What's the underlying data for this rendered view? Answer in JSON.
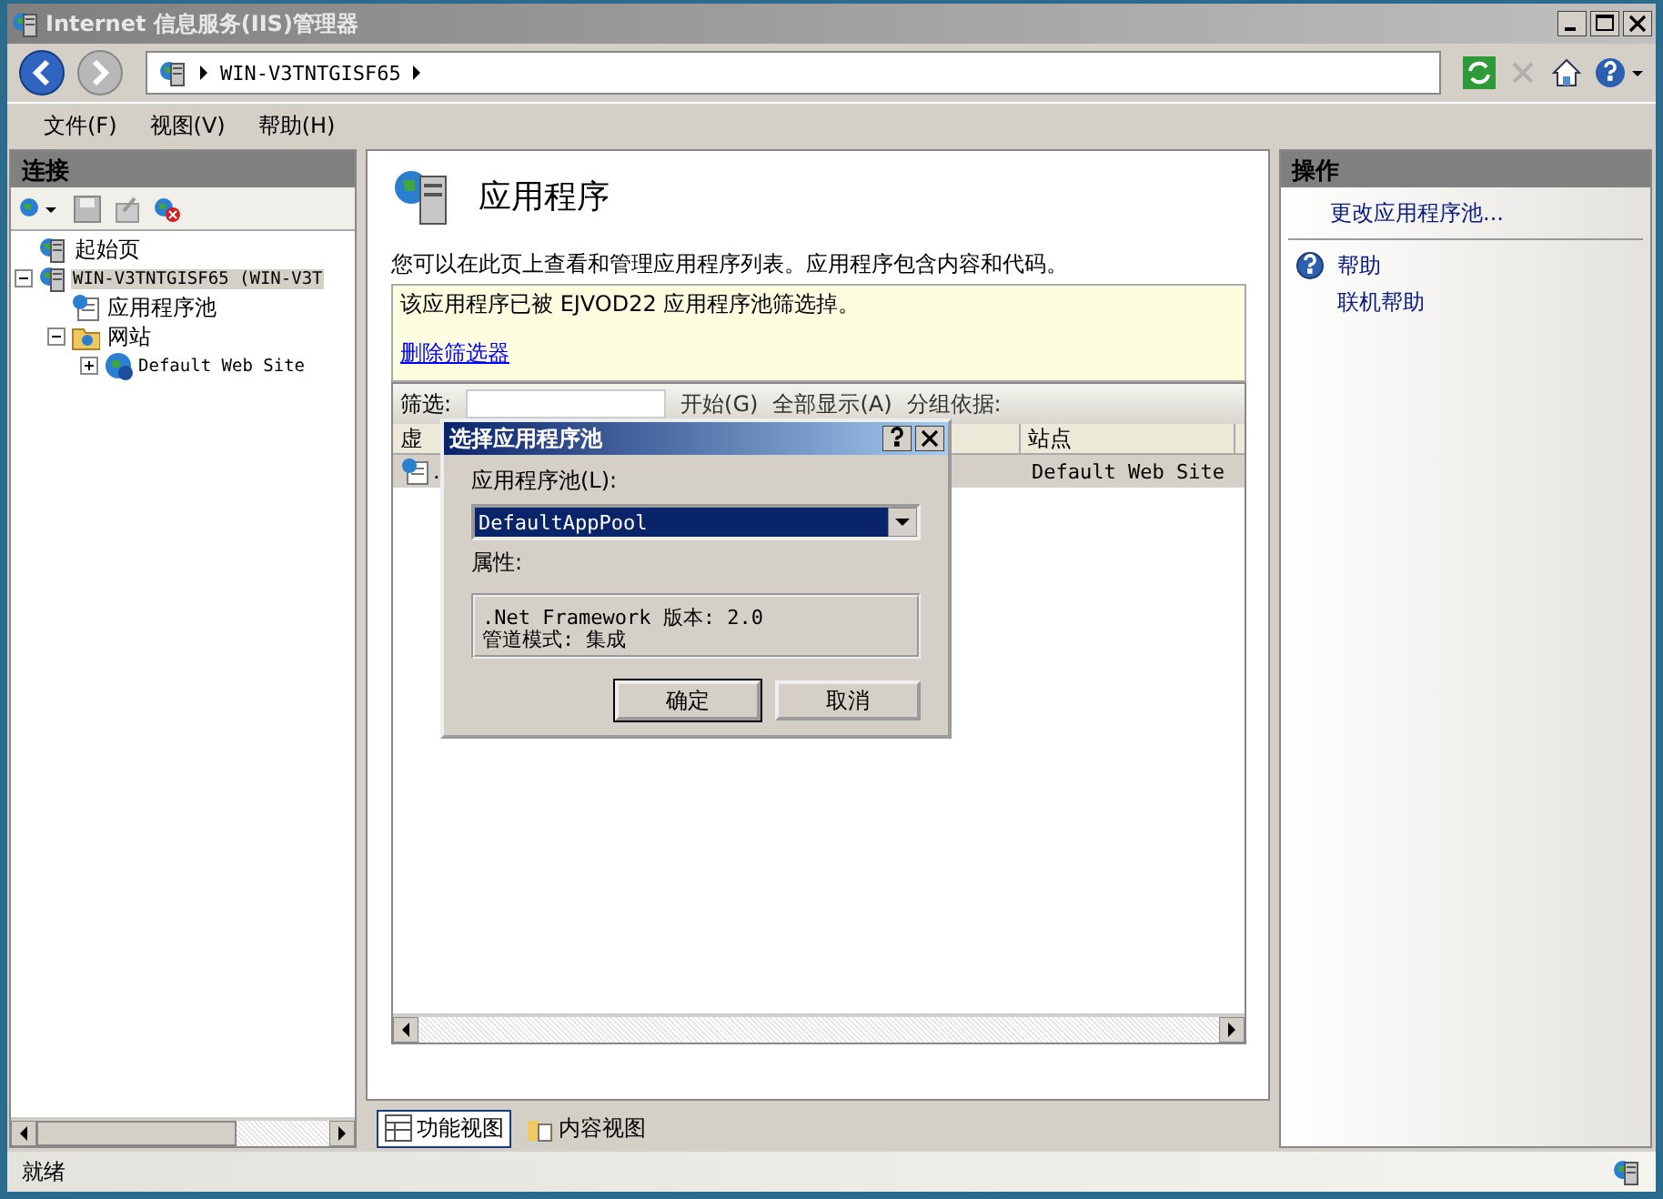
{
  "window": {
    "title": "Internet 信息服务(IIS)管理器"
  },
  "address": {
    "segments": [
      "WIN-V3TNTGISF65"
    ]
  },
  "menu": [
    "文件(F)",
    "视图(V)",
    "帮助(H)"
  ],
  "connections": {
    "title": "连接",
    "tree": [
      {
        "label": "起始页",
        "kind": "start",
        "selected": false
      },
      {
        "label": "WIN-V3TNTGISF65 (WIN-V3T",
        "kind": "server",
        "expanded": true,
        "selected": true,
        "children": [
          {
            "label": "应用程序池",
            "kind": "pool",
            "selected": false
          },
          {
            "label": "网站",
            "kind": "folder",
            "expanded": true,
            "selected": false,
            "children": [
              {
                "label": "Default Web Site",
                "kind": "site",
                "expanded": false,
                "selected": false
              }
            ]
          }
        ]
      }
    ]
  },
  "content": {
    "title": "应用程序",
    "description": "您可以在此页上查看和管理应用程序列表。应用程序包含内容和代码。",
    "notice": {
      "text": "该应用程序已被 EJVOD22 应用程序池筛选掉。",
      "link": "删除筛选器"
    },
    "filter": {
      "label": "筛选:",
      "go": "开始(G)",
      "show_all": "全部显示(A)",
      "group_by": "分组依据:"
    },
    "columns": [
      "虚",
      "站点"
    ],
    "rows": [
      {
        "cells": [
          ".",
          "Default Web Site"
        ],
        "selected": true
      }
    ],
    "view_tabs": [
      {
        "label": "功能视图",
        "selected": true
      },
      {
        "label": "内容视图",
        "selected": false
      }
    ]
  },
  "actions": {
    "title": "操作",
    "groups": [
      [
        {
          "label": "更改应用程序池...",
          "kind": "link"
        }
      ],
      [
        {
          "label": "帮助",
          "kind": "help"
        },
        {
          "label": "联机帮助",
          "kind": "link"
        }
      ]
    ]
  },
  "status_bar": {
    "text": "就绪"
  },
  "dialog": {
    "title": "选择应用程序池",
    "pool_label": "应用程序池(L):",
    "pool_value": "DefaultAppPool",
    "properties_label": "属性:",
    "properties": [
      ".Net Framework 版本: 2.0",
      "管道模式: 集成"
    ],
    "buttons": [
      "确定",
      "取消"
    ]
  }
}
